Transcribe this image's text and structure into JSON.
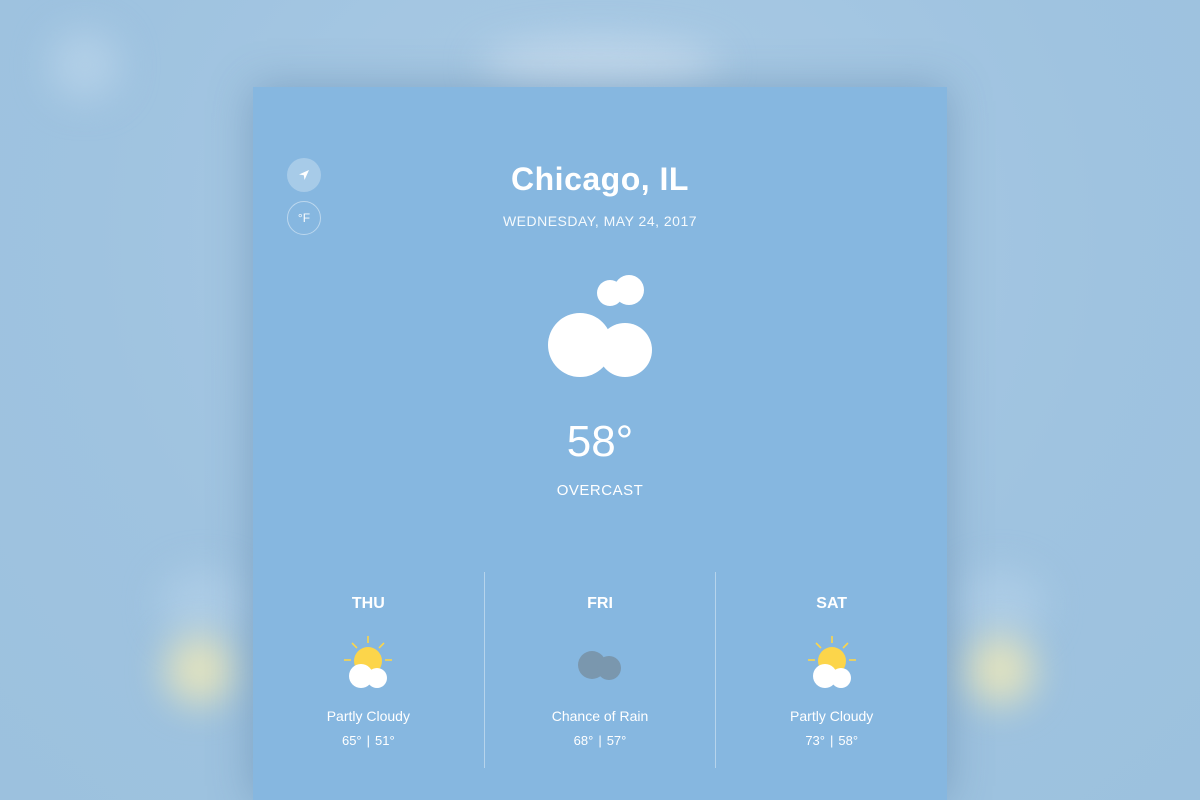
{
  "header": {
    "city": "Chicago, IL",
    "date": "WEDNESDAY, MAY 24, 2017"
  },
  "controls": {
    "location_icon": "location-arrow-icon",
    "unit_label": "°F"
  },
  "current": {
    "icon": "overcast-clouds-icon",
    "temperature": "58°",
    "condition": "OVERCAST"
  },
  "forecast": [
    {
      "day": "THU",
      "icon": "partly-cloudy-icon",
      "condition": "Partly Cloudy",
      "high": "65°",
      "separator": "|",
      "low": "51°"
    },
    {
      "day": "FRI",
      "icon": "rain-cloud-icon",
      "condition": "Chance of Rain",
      "high": "68°",
      "separator": "|",
      "low": "57°"
    },
    {
      "day": "SAT",
      "icon": "partly-cloudy-icon",
      "condition": "Partly Cloudy",
      "high": "73°",
      "separator": "|",
      "low": "58°"
    }
  ],
  "colors": {
    "card_background": "#86b7e0",
    "page_background": "#a3c6e1",
    "sun": "#fcd54a",
    "rain_cloud": "#7a97ae",
    "text": "#ffffff"
  }
}
